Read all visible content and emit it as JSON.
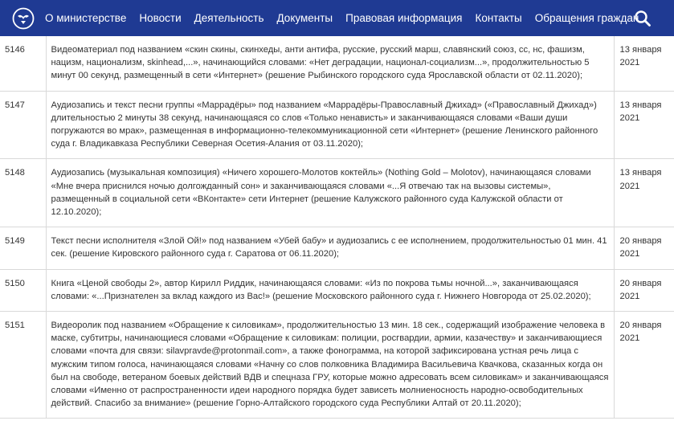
{
  "nav": {
    "logo_icon": "eagle-emblem-icon",
    "items": [
      {
        "label": "О министерстве"
      },
      {
        "label": "Новости"
      },
      {
        "label": "Деятельность"
      },
      {
        "label": "Документы"
      },
      {
        "label": "Правовая информация"
      },
      {
        "label": "Контакты"
      },
      {
        "label": "Обращения граждан"
      }
    ],
    "search_icon": "search-icon",
    "bg_color": "#1f3a93"
  },
  "table": {
    "rows": [
      {
        "num": "5146",
        "text": "Видеоматериал под названием «скин скины, скинхеды, анти антифа, русские, русский марш, славянский союз, сс, нс, фашизм, нацизм, национализм, skinhead,...», начинающийся словами: «Нет деградации, национал-социализм...», продолжительностью 5 минут 00 секунд, размещенный в сети «Интернет» (решение Рыбинского городского суда Ярославской области от 02.11.2020);",
        "date": "13 января 2021"
      },
      {
        "num": "5147",
        "text": "Аудиозапись и текст песни группы «Маррадёры» под названием «Маррадёры-Православный Джихад» («Православный Джихад») длительностью 2 минуты 38 секунд, начинающаяся со слов «Только ненависть» и заканчивающаяся словами «Ваши души погружаются во мрак», размещенная в информационно-телекоммуникационной сети «Интернет» (решение Ленинского районного суда г. Владикавказа Республики Северная Осетия-Алания от 03.11.2020);",
        "date": "13 января 2021"
      },
      {
        "num": "5148",
        "text": "Аудиозапись (музыкальная композиция) «Ничего хорошего-Молотов коктейль» (Nothing Gold – Molotov), начинающаяся словами «Мне вчера приснился ночью долгожданный сон» и заканчивающаяся словами «...Я отвечаю так на вызовы системы», размещенный в социальной сети «ВКонтакте» сети Интернет (решение Калужского районного суда Калужской области от 12.10.2020);",
        "date": "13 января 2021"
      },
      {
        "num": "5149",
        "text": "Текст песни исполнителя «Злой Ой!» под названием «Убей бабу» и аудиозапись с ее исполнением, продолжительностью 01 мин. 41 сек. (решение Кировского районного суда г. Саратова от 06.11.2020);",
        "date": "20 января 2021"
      },
      {
        "num": "5150",
        "text": "Книга «Ценой свободы 2», автор Кирилл Риддик, начинающаяся словами: «Из по покрова тьмы ночной...», заканчивающаяся словами: «...Признателен за вклад каждого из Вас!» (решение Московского районного суда г. Нижнего Новгорода от 25.02.2020);",
        "date": "20 января 2021"
      },
      {
        "num": "5151",
        "text": "Видеоролик под названием «Обращение к силовикам», продолжительностью 13 мин. 18 сек., содержащий изображение человека в маске, субтитры, начинающиеся словами «Обращение к силовикам: полиции, росгвардии, армии, казачеству» и заканчивающиеся словами «почта для связи: silavpravde@protonmail.com», а также фонограмма, на которой зафиксирована устная речь лица с мужским типом голоса, начинающаяся словами «Начну со слов полковника Владимира Васильевича Квачкова, сказанных когда он был на свободе, ветераном боевых действий ВДВ и спецназа ГРУ, которые можно адресовать всем силовикам» и заканчивающаяся словами «Именно от распространенности идеи народного порядка будет зависеть молниеносность народно-освободительных действий. Спасибо за внимание» (решение Горно-Алтайского городского суда Республики Алтай от 20.11.2020);",
        "date": "20 января 2021"
      }
    ]
  }
}
